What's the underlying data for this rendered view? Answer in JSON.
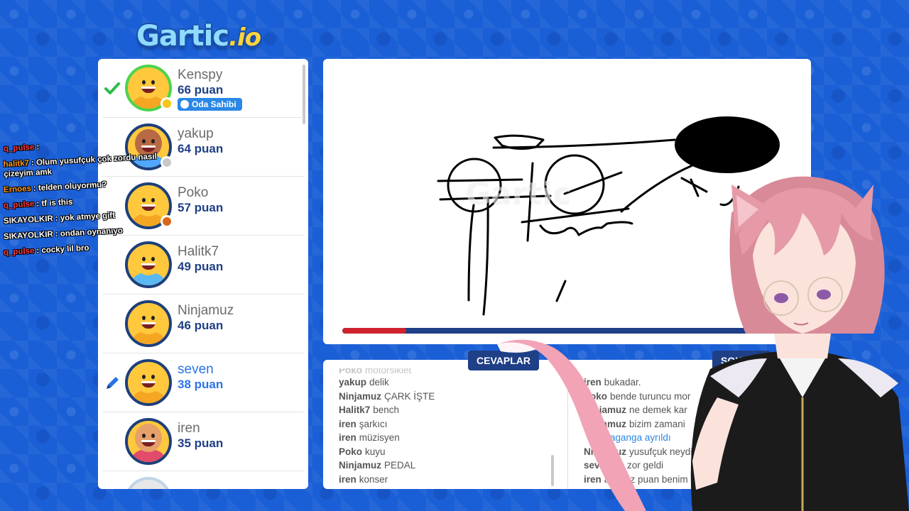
{
  "logo": {
    "main": "Gartic",
    "suffix": ".io"
  },
  "players": [
    {
      "name": "Kenspy",
      "score": "66 puan",
      "status": "check",
      "owner_badge": "Oda Sahibi",
      "dot": "#f5c518",
      "body": "#f5a623",
      "skin": "#ffc83d",
      "first": true
    },
    {
      "name": "yakup",
      "score": "64 puan",
      "status": "",
      "dot": "#c8c8c8",
      "body": "#4fa7ff",
      "skin": "#b86a45"
    },
    {
      "name": "Poko",
      "score": "57 puan",
      "status": "",
      "dot": "#d9661c",
      "body": "#f5a623",
      "skin": "#ffc83d"
    },
    {
      "name": "Halitk7",
      "score": "49 puan",
      "status": "",
      "dot": "",
      "body": "#5ab8f2",
      "skin": "#ffc83d"
    },
    {
      "name": "Ninjamuz",
      "score": "46 puan",
      "status": "",
      "dot": "",
      "body": "#f5a623",
      "skin": "#ffc83d"
    },
    {
      "name": "seven",
      "score": "38 puan",
      "status": "pencil",
      "dot": "",
      "body": "#f5a623",
      "skin": "#ffc83d",
      "me": true
    },
    {
      "name": "iren",
      "score": "35 puan",
      "status": "",
      "dot": "",
      "body": "#e34b6b",
      "skin": "#e6a06a"
    }
  ],
  "stream_chat": [
    {
      "user": "q_pulse",
      "color": "#ff3b3b",
      "text": ":"
    },
    {
      "user": "halitk7",
      "color": "#ff9a1a",
      "text": ": Olum yusufçuk çok zordu nasıl çizeyim amk"
    },
    {
      "user": "Ernoes",
      "color": "#ff9a1a",
      "text": ": telden oluyormu?"
    },
    {
      "user": "q_pulse",
      "color": "#ff3b3b",
      "text": ": tf is this"
    },
    {
      "user": "SIKAYOLKIR",
      "color": "#ffffff",
      "text": ": yok atmye gift"
    },
    {
      "user": "SIKAYOLKIR",
      "color": "#ffffff",
      "text": ": ondan oynanıyo"
    },
    {
      "user": "q_pulse",
      "color": "#ff3b3b",
      "text": ": cocky lil bro"
    }
  ],
  "timer": {
    "progress": 0.14
  },
  "answers": {
    "tab_label": "CEVAPLAR",
    "messages": [
      {
        "user": "Poko",
        "text": "motorsiklet",
        "faded": true
      },
      {
        "user": "yakup",
        "text": "delik"
      },
      {
        "user": "Ninjamuz",
        "text": "ÇARK İŞTE"
      },
      {
        "user": "Halitk7",
        "text": "bench"
      },
      {
        "user": "iren",
        "text": "şarkıcı"
      },
      {
        "user": "iren",
        "text": "müzisyen"
      },
      {
        "user": "Poko",
        "text": "kuyu"
      },
      {
        "user": "Ninjamuz",
        "text": "PEDAL"
      },
      {
        "user": "iren",
        "text": "konser"
      }
    ]
  },
  "chat": {
    "tab_label": "SOHBET",
    "messages": [
      {
        "user": "",
        "text": "",
        "faded": true
      },
      {
        "user": "iren",
        "text": "bukadar."
      },
      {
        "user": "Poko",
        "text": "bende turuncu mor"
      },
      {
        "user": "Ninjamuz",
        "text": "ne demek kar"
      },
      {
        "user": "Ninjamuz",
        "text": "bizim zamani"
      },
      {
        "user": "",
        "text": "Gangaganga ayrıldı",
        "sys": true
      },
      {
        "user": "Ninjamuz",
        "text": "yusufçuk neydi"
      },
      {
        "user": "seven",
        "text": "ne zor geldi"
      },
      {
        "user": "iren",
        "text": "ayıp az puan benim"
      }
    ]
  },
  "colors": {
    "background": "#1a5fd6",
    "navy": "#1f3f86",
    "accent_blue": "#2a87e6",
    "timer_red": "#d0222e"
  }
}
